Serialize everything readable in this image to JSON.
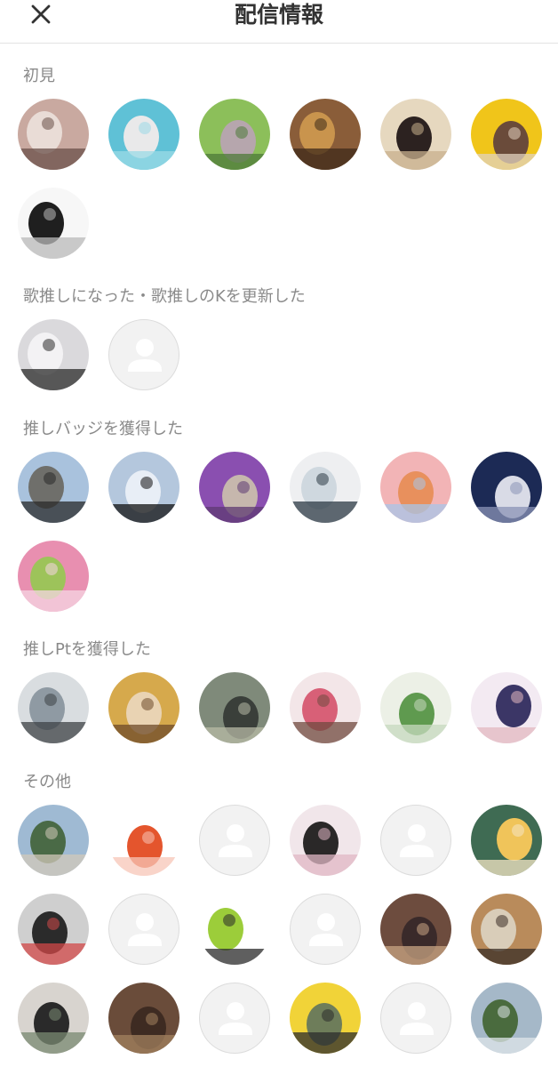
{
  "header": {
    "title": "配信情報",
    "close_icon": "close-icon"
  },
  "sections": [
    {
      "label": "初見",
      "avatars": [
        {
          "kind": "photo",
          "colors": [
            "#c9a9a0",
            "#e9dcd6",
            "#6a5049"
          ]
        },
        {
          "kind": "photo",
          "colors": [
            "#5fc1d6",
            "#e9e9ea",
            "#9ad9e6"
          ]
        },
        {
          "kind": "photo",
          "colors": [
            "#8cbf5a",
            "#b6a6ad",
            "#4d7a39"
          ]
        },
        {
          "kind": "photo",
          "colors": [
            "#8a5d39",
            "#c9944d",
            "#3d2a1a"
          ]
        },
        {
          "kind": "photo",
          "colors": [
            "#e6d8bf",
            "#2c2220",
            "#c8b08d"
          ]
        },
        {
          "kind": "photo",
          "colors": [
            "#f0c51a",
            "#6a4b3a",
            "#e2d2bf"
          ]
        },
        {
          "kind": "photo",
          "colors": [
            "#f7f7f7",
            "#1f1f1f",
            "#b9b9b9"
          ]
        }
      ]
    },
    {
      "label": "歌推しになった・歌推しのKを更新した",
      "avatars": [
        {
          "kind": "photo",
          "colors": [
            "#dad9dc",
            "#f3f2f4",
            "#2b2b2b"
          ]
        },
        {
          "kind": "placeholder"
        }
      ]
    },
    {
      "label": "推しバッジを獲得した",
      "avatars": [
        {
          "kind": "photo",
          "colors": [
            "#a9c2dd",
            "#6f6f6b",
            "#2a2a2a"
          ]
        },
        {
          "kind": "photo",
          "colors": [
            "#b4c7dd",
            "#e8eef6",
            "#111111"
          ]
        },
        {
          "kind": "photo",
          "colors": [
            "#8a4fb0",
            "#c6b7ad",
            "#5d3a73"
          ]
        },
        {
          "kind": "photo",
          "colors": [
            "#eeeff1",
            "#cfd8df",
            "#2c3a44"
          ]
        },
        {
          "kind": "photo",
          "colors": [
            "#f2b4b6",
            "#e8905d",
            "#a8c6e8"
          ]
        },
        {
          "kind": "photo",
          "colors": [
            "#1c2a55",
            "#d9dbe6",
            "#8a93b6"
          ]
        },
        {
          "kind": "photo",
          "colors": [
            "#e88fb0",
            "#9dc35a",
            "#f6d6e3"
          ]
        }
      ]
    },
    {
      "label": "推しPtを獲得した",
      "avatars": [
        {
          "kind": "photo",
          "colors": [
            "#d9dde0",
            "#8f9aa3",
            "#3d4246"
          ]
        },
        {
          "kind": "photo",
          "colors": [
            "#d6a94c",
            "#e9d3b3",
            "#6d4b2a"
          ]
        },
        {
          "kind": "photo",
          "colors": [
            "#7f8a7a",
            "#3a3f3a",
            "#b7b9a6"
          ]
        },
        {
          "kind": "photo",
          "colors": [
            "#f3e6e8",
            "#d86077",
            "#704a3f"
          ]
        },
        {
          "kind": "photo",
          "colors": [
            "#ecf0e6",
            "#5f9a4f",
            "#c7d9bf"
          ]
        },
        {
          "kind": "photo",
          "colors": [
            "#f3eaf2",
            "#3b3666",
            "#e3b8c0"
          ]
        }
      ]
    },
    {
      "label": "その他",
      "avatars": [
        {
          "kind": "photo",
          "colors": [
            "#9fbad3",
            "#4a6a46",
            "#d2c8ba"
          ]
        },
        {
          "kind": "photo",
          "colors": [
            "#ffffff",
            "#e4552d",
            "#f7c5b7"
          ]
        },
        {
          "kind": "placeholder"
        },
        {
          "kind": "photo",
          "colors": [
            "#f1e6ea",
            "#2a2828",
            "#e0b7c4"
          ]
        },
        {
          "kind": "placeholder"
        },
        {
          "kind": "photo",
          "colors": [
            "#3f6b53",
            "#f0c45a",
            "#f6e6c4"
          ]
        },
        {
          "kind": "photo",
          "colors": [
            "#cfcfcf",
            "#2b2b2b",
            "#d14848"
          ]
        },
        {
          "kind": "placeholder"
        },
        {
          "kind": "photo",
          "colors": [
            "#ffffff",
            "#9ccd3a",
            "#2a2a2a"
          ]
        },
        {
          "kind": "placeholder"
        },
        {
          "kind": "photo",
          "colors": [
            "#6d4c3e",
            "#3a2a2a",
            "#c8a483"
          ]
        },
        {
          "kind": "photo",
          "colors": [
            "#b98b5b",
            "#d9cdb9",
            "#3a2e26"
          ]
        },
        {
          "kind": "photo",
          "colors": [
            "#d8d4cf",
            "#2a2a2a",
            "#7a8a72"
          ]
        },
        {
          "kind": "photo",
          "colors": [
            "#6a4c3a",
            "#3e2b22",
            "#a3825f"
          ]
        },
        {
          "kind": "placeholder"
        },
        {
          "kind": "photo",
          "colors": [
            "#f1d338",
            "#6e7d5a",
            "#2c2c2c"
          ]
        },
        {
          "kind": "placeholder"
        },
        {
          "kind": "photo",
          "colors": [
            "#a5b8c8",
            "#4a6b3e",
            "#dfe6ea"
          ]
        }
      ]
    }
  ]
}
